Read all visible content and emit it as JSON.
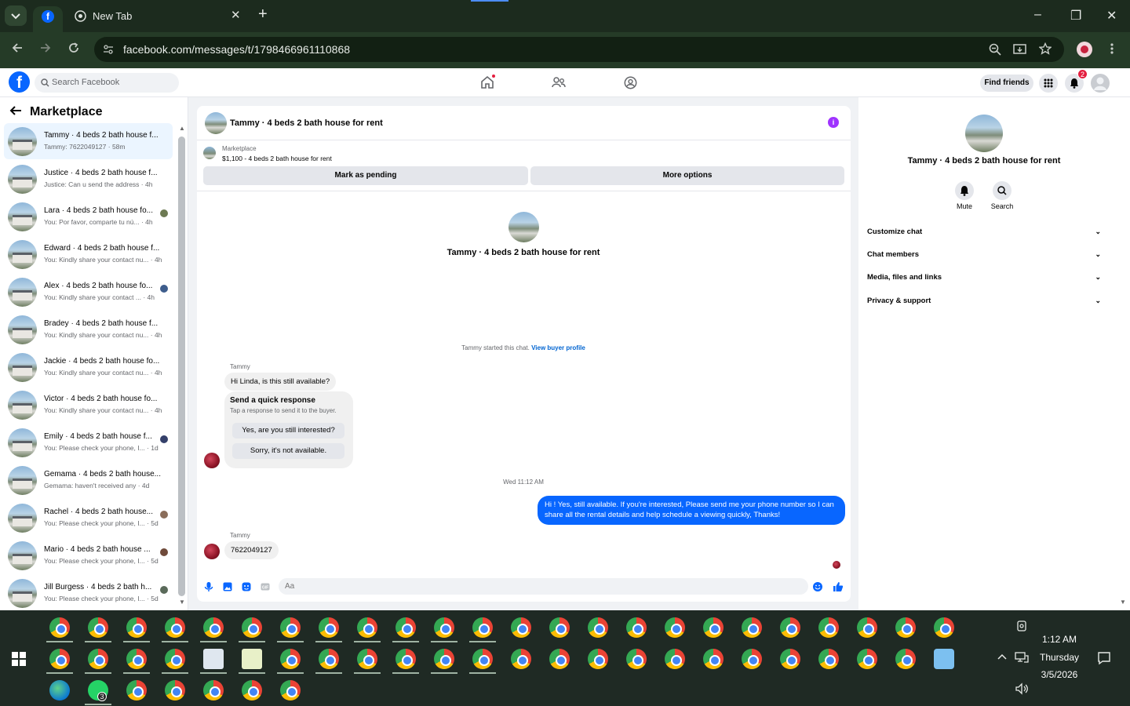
{
  "browser": {
    "tab_title": "New Tab",
    "tab_close": "✕",
    "new_tab": "+",
    "url": "facebook.com/messages/t/1798466961110868",
    "window_controls": {
      "minimize": "–",
      "restore": "❐",
      "close": "✕"
    }
  },
  "fb": {
    "search_placeholder": "Search Facebook",
    "find_friends": "Find friends",
    "notification_count": "2"
  },
  "left": {
    "title": "Marketplace",
    "conversations": [
      {
        "name": "Tammy · 4 beds 2 bath house f...",
        "preview": "Tammy: 7622049127 · 58m",
        "active": true
      },
      {
        "name": "Justice · 4 beds 2 bath house f...",
        "preview": "Justice: Can u send the address · 4h"
      },
      {
        "name": "Lara · 4 beds 2 bath house fo...",
        "preview": "You: Por favor, comparte tu nú... · 4h"
      },
      {
        "name": "Edward · 4 beds 2 bath house f...",
        "preview": "You: Kindly share your contact nu... · 4h"
      },
      {
        "name": "Alex · 4 beds 2 bath house fo...",
        "preview": "You: Kindly share your contact ... · 4h"
      },
      {
        "name": "Bradey · 4 beds 2 bath house f...",
        "preview": "You: Kindly share your contact nu... · 4h"
      },
      {
        "name": "Jackie · 4 beds 2 bath house fo...",
        "preview": "You: Kindly share your contact nu... · 4h"
      },
      {
        "name": "Victor · 4 beds 2 bath house fo...",
        "preview": "You: Kindly share your contact nu... · 4h"
      },
      {
        "name": "Emily · 4 beds 2 bath house f...",
        "preview": "You: Please check your phone, I... · 1d"
      },
      {
        "name": "Gemama · 4 beds 2 bath house...",
        "preview": "Gemama: haven't received any · 4d"
      },
      {
        "name": "Rachel · 4 beds 2 bath house...",
        "preview": "You: Please check your phone, I... · 5d"
      },
      {
        "name": "Mario · 4 beds 2 bath house ...",
        "preview": "You: Please check your phone, I... · 5d"
      },
      {
        "name": "Jill Burgess · 4 beds 2 bath h...",
        "preview": "You: Please check your phone, I... · 5d"
      }
    ]
  },
  "chat": {
    "title": "Tammy · 4 beds 2 bath house for rent",
    "marketplace_label": "Marketplace",
    "listing": "$1,100 - 4 beds 2 bath house for rent",
    "mark_pending": "Mark as pending",
    "more_options": "More options",
    "center_name": "Tammy · 4 beds 2 bath house for rent",
    "started_text": "Tammy started this chat.",
    "view_profile": "View buyer profile",
    "sender": "Tammy",
    "msg1": "Hi Linda, is this still available?",
    "quick_title": "Send a quick response",
    "quick_sub": "Tap a response to send it to the buyer.",
    "quick_opt1": "Yes, are you still interested?",
    "quick_opt2": "Sorry, it's not available.",
    "timestamp": "Wed 11:12 AM",
    "out_msg": "Hi ! Yes, still available. If you're interested, Please send me your phone number so I can share all the rental details and help schedule a viewing quickly, Thanks!",
    "msg2": "7622049127",
    "composer_placeholder": "Aa"
  },
  "right": {
    "name": "Tammy · 4 beds 2 bath house for rent",
    "mute": "Mute",
    "search": "Search",
    "sections": [
      "Customize chat",
      "Chat members",
      "Media, files and links",
      "Privacy & support"
    ]
  },
  "taskbar": {
    "time": "1:12 AM",
    "day": "Thursday",
    "date": "3/5/2026",
    "whatsapp_badge": "3"
  }
}
